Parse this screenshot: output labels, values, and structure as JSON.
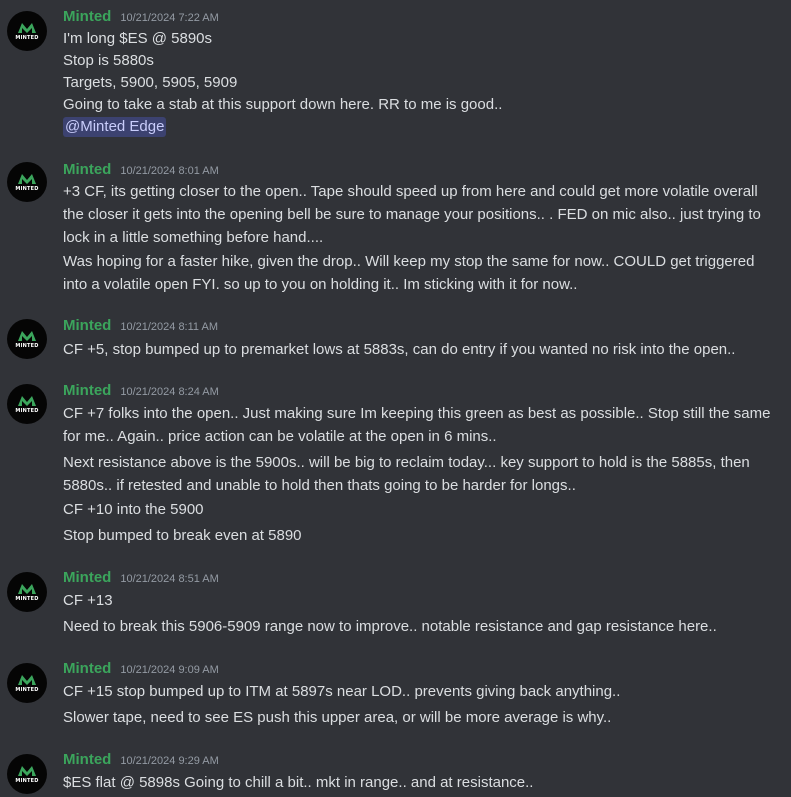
{
  "author_color": "#3ba55c",
  "avatar": {
    "icon": "minted-logo-icon",
    "text": "MINTED"
  },
  "messages": [
    {
      "author": "Minted",
      "timestamp": "10/21/2024 7:22 AM",
      "lines": [
        "I'm long $ES @ 5890s",
        "Stop is 5880s",
        "Targets, 5900, 5905, 5909",
        "Going to take a stab at this support down here. RR  to me is good.."
      ],
      "mention": "@Minted Edge"
    },
    {
      "author": "Minted",
      "timestamp": "10/21/2024 8:01 AM",
      "lines": [
        "+3 CF, its getting closer to the open.. Tape should speed up from here and could get more volatile overall",
        "the closer it gets into the opening bell be sure to manage your positions.. . FED on mic also.. just trying to",
        "lock in a little something before hand....",
        "Was hoping for a faster hike, given the drop.. Will keep my stop the same for now.. COULD get triggered",
        "into a volatile open FYI. so up to you on holding it.. Im sticking with it for now.."
      ]
    },
    {
      "author": "Minted",
      "timestamp": "10/21/2024 8:11 AM",
      "lines": [
        "CF +5, stop bumped up to  premarket lows at 5883s, can do entry if you wanted no risk into the open.."
      ]
    },
    {
      "author": "Minted",
      "timestamp": "10/21/2024 8:24 AM",
      "lines": [
        "CF +7 folks into the open.. Just making sure Im keeping this green as best as possible.. Stop still the same",
        "for me..  Again.. price action can be volatile at the open in 6 mins..",
        "Next resistance above is the 5900s.. will be big to reclaim today... key support to hold is the 5885s, then",
        "5880s.. if retested and unable to hold then thats going to be harder for longs..",
        "CF +10  into the 5900",
        "Stop bumped to break even at 5890"
      ]
    },
    {
      "author": "Minted",
      "timestamp": "10/21/2024 8:51 AM",
      "lines": [
        "CF +13",
        "Need to break this 5906-5909 range now to improve.. notable resistance and gap resistance here.."
      ]
    },
    {
      "author": "Minted",
      "timestamp": "10/21/2024 9:09 AM",
      "lines": [
        "CF +15 stop bumped up to ITM at 5897s near LOD.. prevents giving back anything..",
        "Slower tape, need to see ES push this upper area, or will be more average is why.."
      ]
    },
    {
      "author": "Minted",
      "timestamp": "10/21/2024 9:29 AM",
      "lines": [
        "$ES flat @ 5898s Going to chill a bit.. mkt in range.. and at resistance.."
      ]
    }
  ]
}
